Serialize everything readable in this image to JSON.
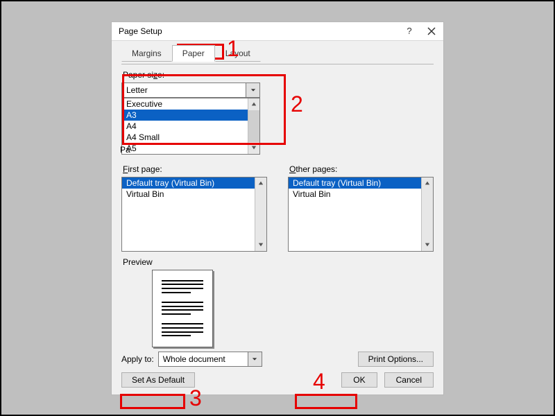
{
  "dialog": {
    "title": "Page Setup",
    "help_icon": "question-mark-icon",
    "close_icon": "close-icon"
  },
  "tabs": {
    "margins": "Margins",
    "paper": "Paper",
    "layout": "Layout"
  },
  "paper_size": {
    "label": "Paper si_ze:",
    "selected": "Letter",
    "options": [
      "Executive",
      "A3",
      "A4",
      "A4 Small",
      "A5"
    ],
    "highlighted": "A3"
  },
  "paper_source": {
    "section_label": "Paper source",
    "first_page": {
      "label": "First page:",
      "items": [
        "Default tray (Virtual Bin)",
        "Virtual Bin"
      ],
      "selected": "Default tray (Virtual Bin)"
    },
    "other_pages": {
      "label": "Other pages:",
      "items": [
        "Default tray (Virtual Bin)",
        "Virtual Bin"
      ],
      "selected": "Default tray (Virtual Bin)"
    }
  },
  "preview": {
    "label": "Preview"
  },
  "apply_to": {
    "label": "Apply to:",
    "value": "Whole document"
  },
  "buttons": {
    "print_options": "Print Options...",
    "set_default": "Set As Default",
    "ok": "OK",
    "cancel": "Cancel"
  },
  "annotations": {
    "n1": "1",
    "n2": "2",
    "n3": "3",
    "n4": "4"
  }
}
